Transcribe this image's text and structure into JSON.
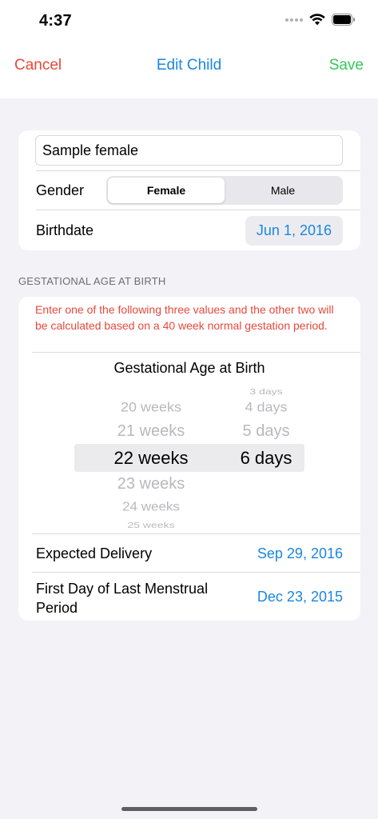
{
  "status_bar": {
    "time": "4:37"
  },
  "nav": {
    "cancel_label": "Cancel",
    "title": "Edit Child",
    "save_label": "Save"
  },
  "child": {
    "name_value": "Sample female",
    "gender_label": "Gender",
    "gender_options": [
      "Female",
      "Male"
    ],
    "gender_selected": "Female",
    "birthdate_label": "Birthdate",
    "birthdate_value": "Jun 1, 2016"
  },
  "gestation": {
    "section_header": "GESTATIONAL AGE AT BIRTH",
    "warning": "Enter one of the following three values and the other two will be calculated based on a 40 week normal gestation period.",
    "picker_title": "Gestational Age at Birth",
    "weeks_options": [
      "20 weeks",
      "21 weeks",
      "22 weeks",
      "23 weeks",
      "24 weeks",
      "25 weeks"
    ],
    "weeks_selected": "22 weeks",
    "days_options": [
      "3 days",
      "4 days",
      "5 days",
      "6 days"
    ],
    "days_selected": "6 days",
    "expected_delivery_label": "Expected Delivery",
    "expected_delivery_value": "Sep 29, 2016",
    "lmp_label_line1": "First Day of Last Menstrual",
    "lmp_label_line2": "Period",
    "lmp_value": "Dec 23, 2015"
  },
  "colors": {
    "accent_blue": "#1b86e0",
    "cancel_red": "#e8483b",
    "save_green": "#35c759",
    "background": "#f2f2f7"
  }
}
